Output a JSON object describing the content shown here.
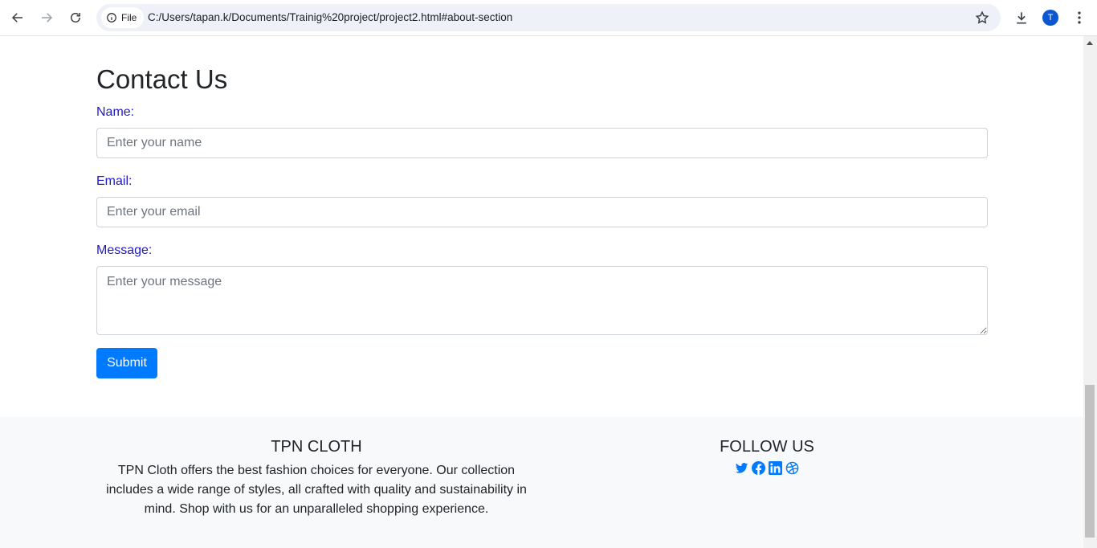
{
  "browser": {
    "file_chip_label": "File",
    "url": "C:/Users/tapan.k/Documents/Trainig%20project/project2.html#about-section",
    "avatar_letter": "T"
  },
  "contact": {
    "title": "Contact Us",
    "name_label": "Name:",
    "name_placeholder": "Enter your name",
    "email_label": "Email:",
    "email_placeholder": "Enter your email",
    "message_label": "Message:",
    "message_placeholder": "Enter your message",
    "submit_label": "Submit"
  },
  "footer": {
    "brand_heading": "TPN CLOTH",
    "brand_text": "TPN Cloth offers the best fashion choices for everyone. Our collection includes a wide range of styles, all crafted with quality and sustainability in mind. Shop with us for an unparalleled shopping experience.",
    "follow_heading": "FOLLOW US",
    "social_icons": [
      "twitter-icon",
      "facebook-icon",
      "linkedin-icon",
      "dribbble-icon"
    ]
  },
  "colors": {
    "label": "#1f18c9",
    "primary": "#007bff",
    "footer_bg": "#f8f9fa"
  }
}
